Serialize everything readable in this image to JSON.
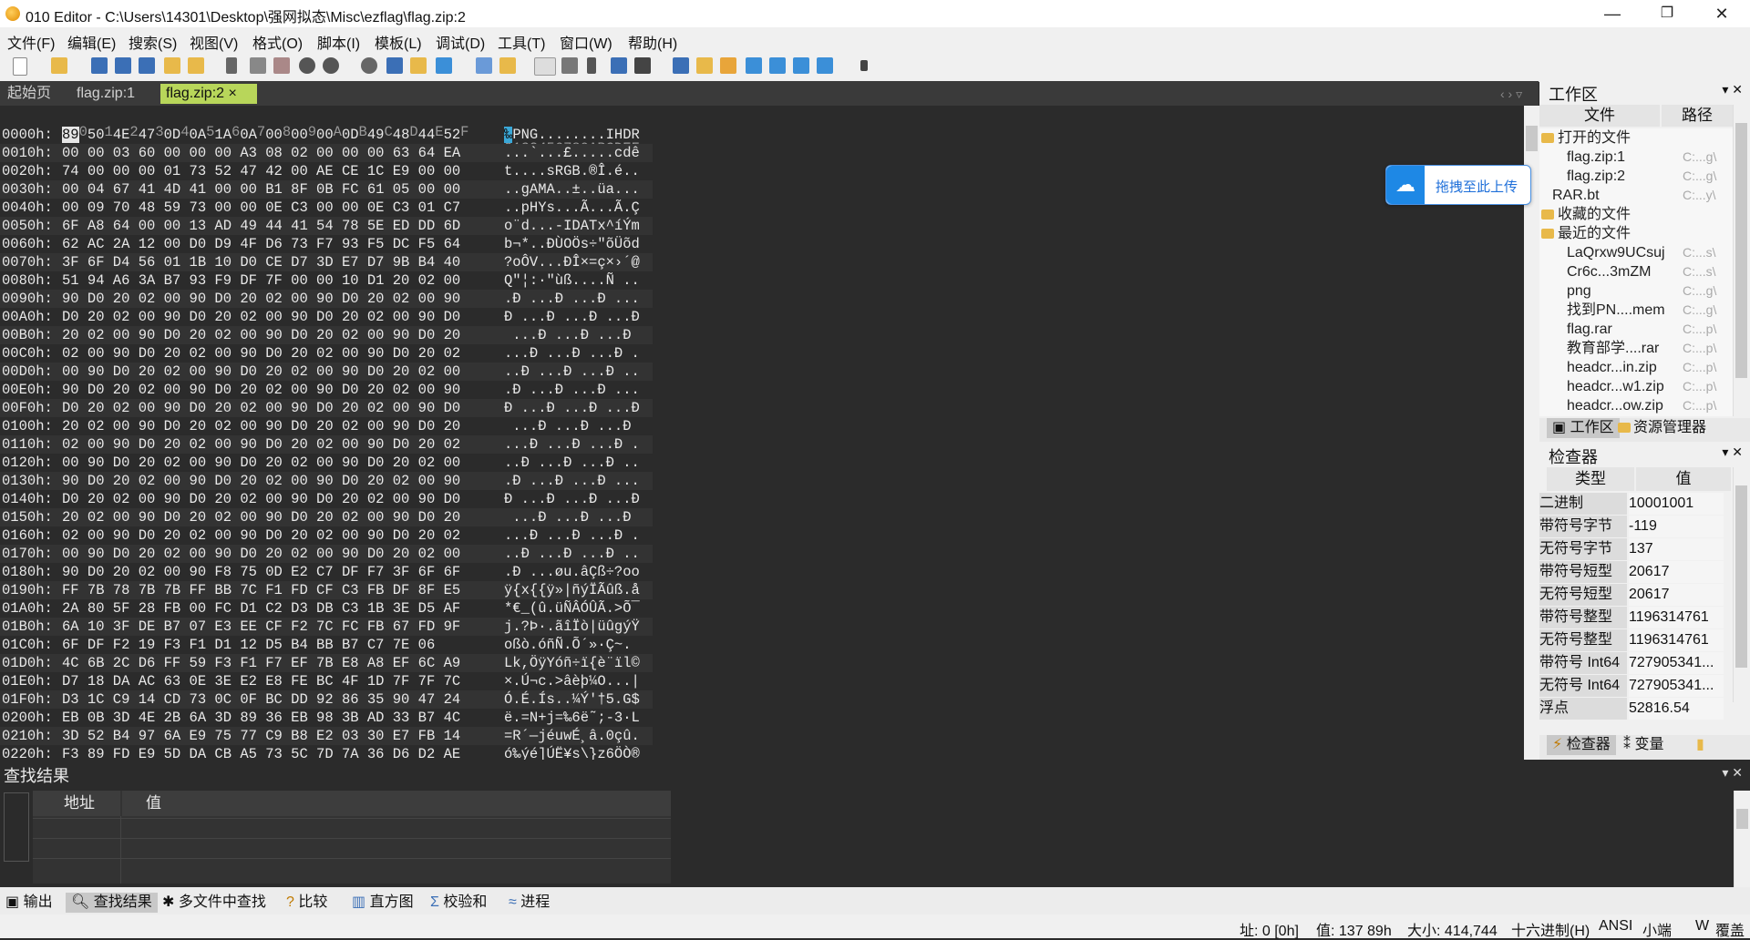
{
  "window": {
    "title": "010 Editor - C:\\Users\\14301\\Desktop\\强网拟态\\Misc\\ezflag\\flag.zip:2",
    "minimize": "—",
    "restore": "❐",
    "close": "✕"
  },
  "menu": [
    "文件(F)",
    "编辑(E)",
    "搜索(S)",
    "视图(V)",
    "格式(O)",
    "脚本(I)",
    "模板(L)",
    "调试(D)",
    "工具(T)",
    "窗口(W)",
    "帮助(H)"
  ],
  "tabs": {
    "items": [
      "起始页",
      "flag.zip:1",
      "flag.zip:2"
    ],
    "active_close": "×",
    "nav": "‹ › ▿"
  },
  "hex": {
    "col_header": "  0  1  2  3  4  5  6  7  8  9  A  B  C  D  E  F",
    "ascii_header": "0123456789ABCDEF",
    "first_byte": "89",
    "first_ascii": "‰",
    "rows": [
      {
        "a": "0000h:",
        "h": "89 50 4E 47 0D 0A 1A 0A 00 00 00 0D 49 48 44 52",
        "s": "‰PNG........IHDR"
      },
      {
        "a": "0010h:",
        "h": "00 00 03 60 00 00 00 A3 08 02 00 00 00 63 64 EA",
        "s": "...`...£.....cdê"
      },
      {
        "a": "0020h:",
        "h": "74 00 00 00 01 73 52 47 42 00 AE CE 1C E9 00 00",
        "s": "t....sRGB.®Î.é.."
      },
      {
        "a": "0030h:",
        "h": "00 04 67 41 4D 41 00 00 B1 8F 0B FC 61 05 00 00",
        "s": "..gAMA..±..üa..."
      },
      {
        "a": "0040h:",
        "h": "00 09 70 48 59 73 00 00 0E C3 00 00 0E C3 01 C7",
        "s": "..pHYs...Ã...Ã.Ç"
      },
      {
        "a": "0050h:",
        "h": "6F A8 64 00 00 13 AD 49 44 41 54 78 5E ED DD 6D",
        "s": "o¨d...-IDATx^íÝm"
      },
      {
        "a": "0060h:",
        "h": "62 AC 2A 12 00 D0 D9 4F D6 73 F7 93 F5 DC F5 64",
        "s": "b¬*..ÐÙOÖs÷\"õÜõd"
      },
      {
        "a": "0070h:",
        "h": "3F 6F D4 56 01 1B 10 D0 CE D7 3D E7 D7 9B B4 40",
        "s": "?oÔV...ÐÎ×=ç×›´@"
      },
      {
        "a": "0080h:",
        "h": "51 94 A6 3A B7 93 F9 DF 7F 00 00 10 D1 20 02 00",
        "s": "Q\"¦:·\"ùß....Ñ .."
      },
      {
        "a": "0090h:",
        "h": "90 D0 20 02 00 90 D0 20 02 00 90 D0 20 02 00 90",
        "s": ".Ð ...Ð ...Ð ..."
      },
      {
        "a": "00A0h:",
        "h": "D0 20 02 00 90 D0 20 02 00 90 D0 20 02 00 90 D0",
        "s": "Ð ...Ð ...Ð ...Ð"
      },
      {
        "a": "00B0h:",
        "h": "20 02 00 90 D0 20 02 00 90 D0 20 02 00 90 D0 20",
        "s": " ...Ð ...Ð ...Ð "
      },
      {
        "a": "00C0h:",
        "h": "02 00 90 D0 20 02 00 90 D0 20 02 00 90 D0 20 02",
        "s": "...Ð ...Ð ...Ð ."
      },
      {
        "a": "00D0h:",
        "h": "00 90 D0 20 02 00 90 D0 20 02 00 90 D0 20 02 00",
        "s": "..Ð ...Ð ...Ð .."
      },
      {
        "a": "00E0h:",
        "h": "90 D0 20 02 00 90 D0 20 02 00 90 D0 20 02 00 90",
        "s": ".Ð ...Ð ...Ð ..."
      },
      {
        "a": "00F0h:",
        "h": "D0 20 02 00 90 D0 20 02 00 90 D0 20 02 00 90 D0",
        "s": "Ð ...Ð ...Ð ...Ð"
      },
      {
        "a": "0100h:",
        "h": "20 02 00 90 D0 20 02 00 90 D0 20 02 00 90 D0 20",
        "s": " ...Ð ...Ð ...Ð "
      },
      {
        "a": "0110h:",
        "h": "02 00 90 D0 20 02 00 90 D0 20 02 00 90 D0 20 02",
        "s": "...Ð ...Ð ...Ð ."
      },
      {
        "a": "0120h:",
        "h": "00 90 D0 20 02 00 90 D0 20 02 00 90 D0 20 02 00",
        "s": "..Ð ...Ð ...Ð .."
      },
      {
        "a": "0130h:",
        "h": "90 D0 20 02 00 90 D0 20 02 00 90 D0 20 02 00 90",
        "s": ".Ð ...Ð ...Ð ..."
      },
      {
        "a": "0140h:",
        "h": "D0 20 02 00 90 D0 20 02 00 90 D0 20 02 00 90 D0",
        "s": "Ð ...Ð ...Ð ...Ð"
      },
      {
        "a": "0150h:",
        "h": "20 02 00 90 D0 20 02 00 90 D0 20 02 00 90 D0 20",
        "s": " ...Ð ...Ð ...Ð "
      },
      {
        "a": "0160h:",
        "h": "02 00 90 D0 20 02 00 90 D0 20 02 00 90 D0 20 02",
        "s": "...Ð ...Ð ...Ð ."
      },
      {
        "a": "0170h:",
        "h": "00 90 D0 20 02 00 90 D0 20 02 00 90 D0 20 02 00",
        "s": "..Ð ...Ð ...Ð .."
      },
      {
        "a": "0180h:",
        "h": "90 D0 20 02 00 90 F8 75 0D E2 C7 DF F7 3F 6F 6F",
        "s": ".Ð ...øu.âÇß÷?oo"
      },
      {
        "a": "0190h:",
        "h": "FF 7B 78 7B 7B FF BB 7C F1 FD CF C3 FB DF 8F E5",
        "s": "ÿ{x{{ÿ»|ñýÏÃûß.å"
      },
      {
        "a": "01A0h:",
        "h": "2A 80 5F 28 FB 00 FC D1 C2 D3 DB C3 1B 3E D5 AF",
        "s": "*€_(û.üÑÂÓÛÃ.>Õ¯"
      },
      {
        "a": "01B0h:",
        "h": "6A 10 3F DE B7 07 E3 EE CF F2 7C FC FB 67 FD 9F",
        "s": "j.?Þ·.ãîÏò|üûgýŸ"
      },
      {
        "a": "01C0h:",
        "h": "6F DF F2 19 F3 F1 D1 12 D5 B4 BB B7 C7 7E 06",
        "s": "oßò.óñÑ.Õ´»·Ç~."
      },
      {
        "a": "01D0h:",
        "h": "4C 6B 2C D6 FF 59 F3 F1 F7 EF 7B E8 A8 EF 6C A9",
        "s": "Lk,ÖÿYóñ÷ï{è¨ïl©"
      },
      {
        "a": "01E0h:",
        "h": "D7 18 DA AC 63 0E 3E E2 E8 FE BC 4F 1D 7F 7F 7C",
        "s": "×.Ú¬c.>âèþ¼O...|"
      },
      {
        "a": "01F0h:",
        "h": "D3 1C C9 14 CD 73 0C 0F BC DD 92 86 35 90 47 24",
        "s": "Ó.É.Ís..¼Ý'†5.G$"
      },
      {
        "a": "0200h:",
        "h": "EB 0B 3D 4E 2B 6A 3D 89 36 EB 98 3B AD 33 B7 4C",
        "s": "ë.=N+j=‰6ë˜;-3·L"
      },
      {
        "a": "0210h:",
        "h": "3D 52 B4 97 6A E9 75 77 C9 B8 E2 03 30 E7 FB 14",
        "s": "=R´—jéuwÉ¸â.0çû."
      },
      {
        "a": "0220h:",
        "h": "F3 89 FD E9 5D DA CB A5 73 5C 7D 7A 36 D6 D2 AE",
        "s": "ó‰ýé]ÚË¥s\\}z6ÖÒ®"
      }
    ]
  },
  "upload_widget": {
    "label": "拖拽至此上传"
  },
  "workspace": {
    "title": "工作区",
    "title_ctrl": "▾ ✕",
    "col_file": "文件",
    "col_path": "路径",
    "groups": [
      {
        "label": "打开的文件",
        "items": [
          {
            "name": "flag.zip:1",
            "path": "C:...g\\"
          },
          {
            "name": "flag.zip:2",
            "path": "C:...g\\"
          },
          {
            "name": "RAR.bt",
            "path": "C:...y\\"
          }
        ]
      },
      {
        "label": "收藏的文件",
        "items": []
      },
      {
        "label": "最近的文件",
        "items": [
          {
            "name": "LaQrxw9UCsuj",
            "path": "C:...s\\"
          },
          {
            "name": "Cr6c...3mZM",
            "path": "C:...s\\"
          },
          {
            "name": "png",
            "path": "C:...g\\"
          },
          {
            "name": "找到PN....mem",
            "path": "C:...g\\"
          },
          {
            "name": "flag.rar",
            "path": "C:...p\\"
          },
          {
            "name": "教育部学....rar",
            "path": "C:...p\\"
          },
          {
            "name": "headcr...in.zip",
            "path": "C:...p\\"
          },
          {
            "name": "headcr...w1.zip",
            "path": "C:...p\\"
          },
          {
            "name": "headcr...ow.zip",
            "path": "C:...p\\"
          }
        ]
      }
    ],
    "tabs": [
      "工作区",
      "资源管理器"
    ]
  },
  "inspector": {
    "title": "检查器",
    "title_ctrl": "▾ ✕",
    "col_type": "类型",
    "col_value": "值",
    "rows": [
      {
        "k": "二进制",
        "v": "10001001"
      },
      {
        "k": "带符号字节",
        "v": "-119"
      },
      {
        "k": "无符号字节",
        "v": "137"
      },
      {
        "k": "带符号短型",
        "v": "20617"
      },
      {
        "k": "无符号短型",
        "v": "20617"
      },
      {
        "k": "带符号整型",
        "v": "1196314761"
      },
      {
        "k": "无符号整型",
        "v": "1196314761"
      },
      {
        "k": "带符号 Int64",
        "v": "727905341..."
      },
      {
        "k": "无符号 Int64",
        "v": "727905341..."
      },
      {
        "k": "浮点",
        "v": "52816.54"
      }
    ],
    "tabs": [
      "检查器",
      "变量"
    ]
  },
  "find": {
    "title": "查找结果",
    "title_ctrl": "▾ ✕",
    "col_addr": "地址",
    "col_value": "值"
  },
  "bottom_tabs": [
    "输出",
    "查找结果",
    "多文件中查找",
    "比较",
    "直方图",
    "校验和",
    "进程"
  ],
  "status": {
    "pos": "址: 0 [0h]",
    "value": "值: 137 89h",
    "size": "大小: 414,744",
    "mode": "十六进制(H)",
    "charset": "ANSI",
    "endian": "小端",
    "w": "W",
    "ovr": "覆盖"
  },
  "colors": {
    "accent_tab": "#b8d65a",
    "hex_bg": "#2b2b2b",
    "selection": "#3aa8d8",
    "upload_blue": "#1e88e5"
  }
}
